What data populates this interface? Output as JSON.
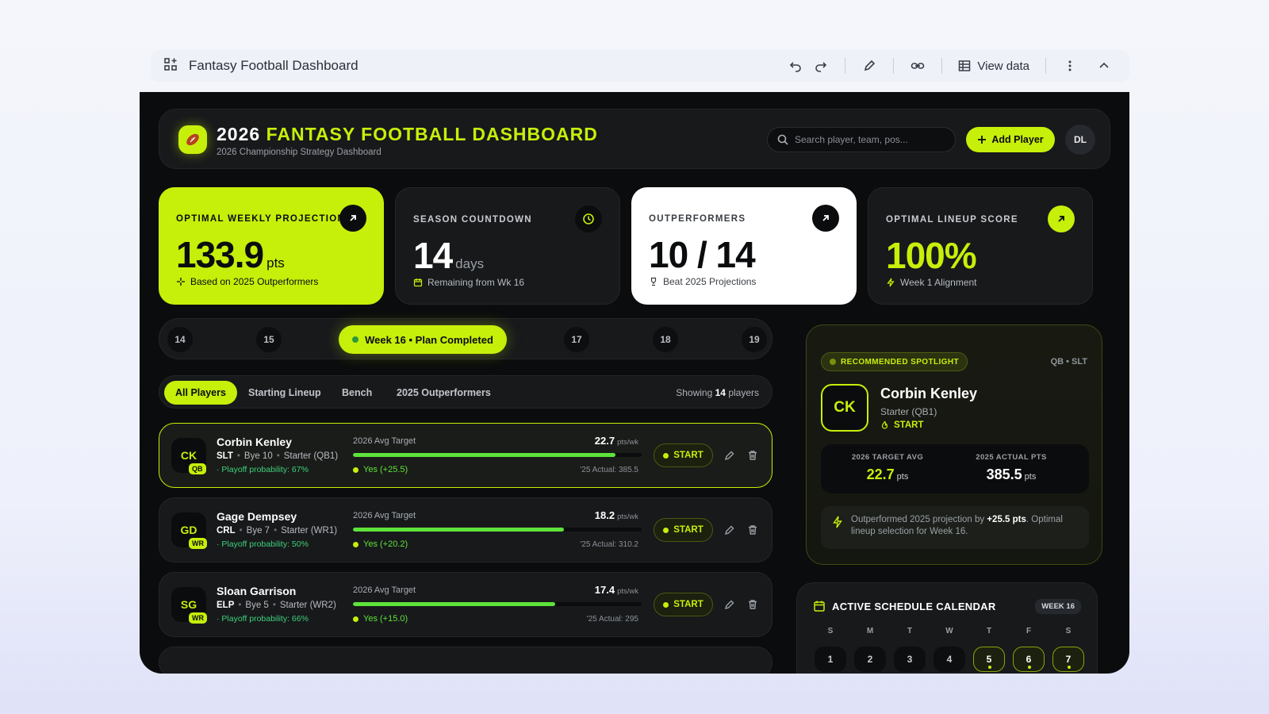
{
  "topbar": {
    "title": "Fantasy Football Dashboard",
    "view_data": "View data"
  },
  "header": {
    "title_white": "2026",
    "title_accent": "FANTASY FOOTBALL DASHBOARD",
    "subtitle": "2026 Championship Strategy Dashboard",
    "search_placeholder": "Search player, team, pos...",
    "add_player": "Add Player",
    "avatar": "DL"
  },
  "stats": [
    {
      "label": "OPTIMAL WEEKLY PROJECTION",
      "value": "133.9",
      "unit": "pts",
      "foot": "Based on 2025 Outperformers"
    },
    {
      "label": "SEASON COUNTDOWN",
      "value": "14",
      "unit": "days",
      "foot": "Remaining from Wk 16"
    },
    {
      "label": "OUTPERFORMERS",
      "value": "10 / 14",
      "unit": "",
      "foot": "Beat 2025 Projections"
    },
    {
      "label": "OPTIMAL LINEUP SCORE",
      "value": "100%",
      "unit": "",
      "foot": "Week 1 Alignment"
    }
  ],
  "weeks": {
    "items": [
      "14",
      "15",
      "17",
      "18",
      "19"
    ],
    "active": "Week 16 • Plan Completed"
  },
  "tabs": {
    "items": [
      "All Players",
      "Starting Lineup",
      "Bench",
      "2025 Outperformers"
    ],
    "showing_prefix": "Showing",
    "showing_count": "14",
    "showing_suffix": "players"
  },
  "players": [
    {
      "initials": "CK",
      "pos": "QB",
      "name": "Corbin Kenley",
      "team": "SLT",
      "bye": "Bye 10",
      "role": "Starter (QB1)",
      "prob": "· Playoff probability: 67%",
      "target_label": "2026 Avg Target",
      "target": "22.7",
      "target_unit": "pts/wk",
      "bar": 0.91,
      "yes": "Yes (+25.5)",
      "actual": "'25 Actual: 385.5",
      "start": "START"
    },
    {
      "initials": "GD",
      "pos": "WR",
      "name": "Gage Dempsey",
      "team": "CRL",
      "bye": "Bye 7",
      "role": "Starter (WR1)",
      "prob": "· Playoff probability: 50%",
      "target_label": "2026 Avg Target",
      "target": "18.2",
      "target_unit": "pts/wk",
      "bar": 0.73,
      "yes": "Yes (+20.2)",
      "actual": "'25 Actual: 310.2",
      "start": "START"
    },
    {
      "initials": "SG",
      "pos": "WR",
      "name": "Sloan Garrison",
      "team": "ELP",
      "bye": "Bye 5",
      "role": "Starter (WR2)",
      "prob": "· Playoff probability: 66%",
      "target_label": "2026 Avg Target",
      "target": "17.4",
      "target_unit": "pts/wk",
      "bar": 0.7,
      "yes": "Yes (+15.0)",
      "actual": "'25 Actual: 295",
      "start": "START"
    }
  ],
  "spotlight": {
    "badge": "RECOMMENDED SPOTLIGHT",
    "pos": "QB • SLT",
    "initials": "CK",
    "name": "Corbin Kenley",
    "role": "Starter (QB1)",
    "status": "START",
    "stat1_label": "2026 TARGET AVG",
    "stat1_value": "22.7",
    "stat1_unit": "pts",
    "stat2_label": "2025 ACTUAL PTS",
    "stat2_value": "385.5",
    "stat2_unit": "pts",
    "note_a": "Outperformed 2025 projection by",
    "note_b": "+25.5 pts",
    "note_c": ". Optimal lineup selection for Week 16."
  },
  "calendar": {
    "title": "ACTIVE SCHEDULE CALENDAR",
    "week": "WEEK 16",
    "dow": [
      "S",
      "M",
      "T",
      "W",
      "T",
      "F",
      "S"
    ],
    "days": [
      "1",
      "2",
      "3",
      "4",
      "5",
      "6",
      "7"
    ]
  },
  "colors": {
    "accent": "#c6ef0a",
    "background": "#0b0c0d",
    "card": "#17191b",
    "positive": "#5ee33a"
  }
}
